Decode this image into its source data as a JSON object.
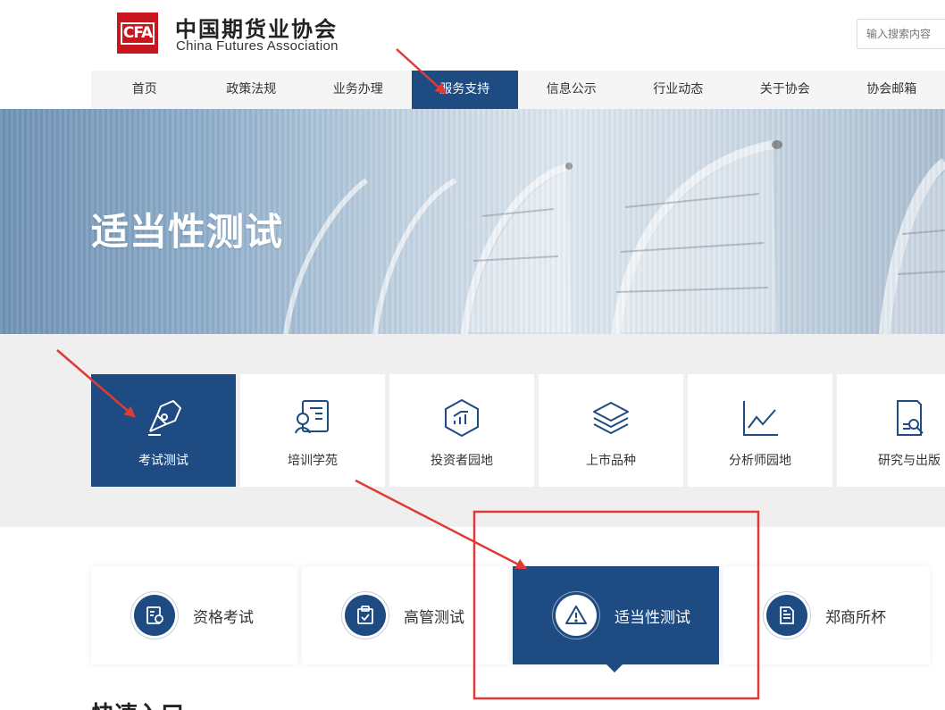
{
  "header": {
    "logo_mark": "CFA",
    "logo_cn": "中国期货业协会",
    "logo_en": "China Futures Association",
    "search_placeholder": "输入搜索内容"
  },
  "nav": {
    "items": [
      {
        "label": "首页",
        "active": false
      },
      {
        "label": "政策法规",
        "active": false
      },
      {
        "label": "业务办理",
        "active": false
      },
      {
        "label": "服务支持",
        "active": true
      },
      {
        "label": "信息公示",
        "active": false
      },
      {
        "label": "行业动态",
        "active": false
      },
      {
        "label": "关于协会",
        "active": false
      },
      {
        "label": "协会邮箱",
        "active": false
      }
    ]
  },
  "banner": {
    "title": "适当性测试"
  },
  "tiles": [
    {
      "label": "考试测试",
      "icon": "pen-nib-icon",
      "active": true
    },
    {
      "label": "培训学苑",
      "icon": "certificate-icon",
      "active": false
    },
    {
      "label": "投资者园地",
      "icon": "hexagon-chart-icon",
      "active": false
    },
    {
      "label": "上市品种",
      "icon": "layers-icon",
      "active": false
    },
    {
      "label": "分析师园地",
      "icon": "line-chart-icon",
      "active": false
    },
    {
      "label": "研究与出版",
      "icon": "document-search-icon",
      "active": false
    }
  ],
  "subtabs": [
    {
      "label": "资格考试",
      "icon": "exam-icon",
      "active": false
    },
    {
      "label": "高管测试",
      "icon": "clipboard-check-icon",
      "active": false
    },
    {
      "label": "适当性测试",
      "icon": "warning-icon",
      "active": true
    },
    {
      "label": "郑商所杯",
      "icon": "document-icon",
      "active": false
    }
  ],
  "section": {
    "title": "快速入口"
  },
  "colors": {
    "primary": "#1e4b82",
    "annotation": "#e03a36",
    "brand_red": "#c7161e"
  }
}
